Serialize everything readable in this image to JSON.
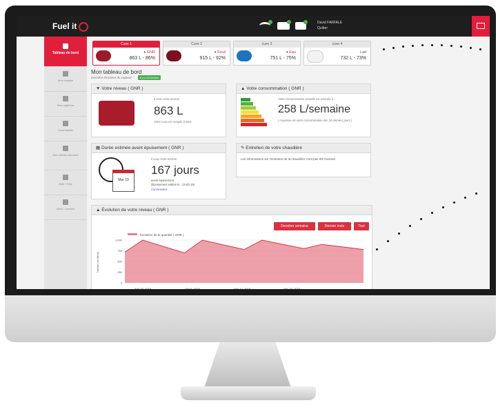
{
  "header": {
    "logo": "Fuel it",
    "user_name": "David FARFALE",
    "logout": "Quitter"
  },
  "sidebar": {
    "items": [
      {
        "label": "Tableau de bord",
        "icon": "home-icon"
      },
      {
        "label": "Mon compte",
        "icon": "user-icon"
      },
      {
        "label": "Mes capteurs",
        "icon": "sensor-icon"
      },
      {
        "label": "Commander",
        "icon": "cart-icon"
      },
      {
        "label": "Mes alertes Ma cuve",
        "icon": "bell-icon"
      },
      {
        "label": "Aide / FAQ",
        "icon": "book-icon"
      },
      {
        "label": "Infos / Contact",
        "icon": "info-icon"
      }
    ]
  },
  "tanks": [
    {
      "title": "Cuve 1",
      "fuel": "GNR",
      "value": "863 L - 86%",
      "color": "#9b1b2b"
    },
    {
      "title": "Cuve 2",
      "fuel": "Fioul",
      "value": "915 L - 92%",
      "color": "#7a1020"
    },
    {
      "title": "cuve 3",
      "fuel": "Eau",
      "value": "751 L - 75%",
      "color": "#1e73be"
    },
    {
      "title": "cuve 4",
      "fuel": "Lait",
      "value": "732 L - 73%",
      "color": "#f2f2f2"
    }
  ],
  "dashboard": {
    "title": "Mon tableau de bord",
    "subtitle": "Dernière émission du capteur :",
    "badge": "Il y a 10 heures"
  },
  "level_panel": {
    "title": "Votre niveau ( GNR )",
    "intro": "Il vous reste environ",
    "value": "863 L",
    "note": "Votre cuve est remplie à 86%"
  },
  "consumption_panel": {
    "title": "Votre consommation ( GNR )",
    "intro": "Votre consommation actuelle est estimée à :",
    "value": "258 L/semaine",
    "note": "( moyenne de votre consommation des 28 derniers jours )"
  },
  "duration_panel": {
    "title": "Durée estimée avant épuisement ( GNR )",
    "intro": "Il vous reste environ",
    "value": "167 jours",
    "line1": "avant épuisement.",
    "line2": "(Épuisement estimé le : 13-03-19)",
    "link": "Commandez",
    "calendar_label": "Mar 19"
  },
  "boiler_panel": {
    "title": "Entretien de votre chaudière",
    "text": "Les informations sur l'entretien de la chaudière n'ont pas été fournies"
  },
  "evolution_panel": {
    "title": "Évolution de votre niveau ( GNR )",
    "buttons": [
      "Dernière semaine",
      "Dernier mois",
      "Tout"
    ]
  },
  "chart_data": {
    "type": "area",
    "title": "",
    "legend": "Évolution de la quantité ( GNR )",
    "ylabel": "Niveau (en litres)",
    "ylim": [
      0,
      1000
    ],
    "yticks": [
      "1,000",
      "750",
      "500",
      "250",
      "0"
    ],
    "xticks": [
      "Aug 29, 2018",
      "Sep 5, 2018",
      "Sep 12, 2018",
      "Sep 19, 2018"
    ],
    "x": [
      0,
      3,
      10,
      13,
      20,
      23,
      30,
      33,
      40
    ],
    "y": [
      720,
      1000,
      700,
      1000,
      780,
      1000,
      800,
      900,
      780
    ],
    "color": "#e8808e"
  }
}
